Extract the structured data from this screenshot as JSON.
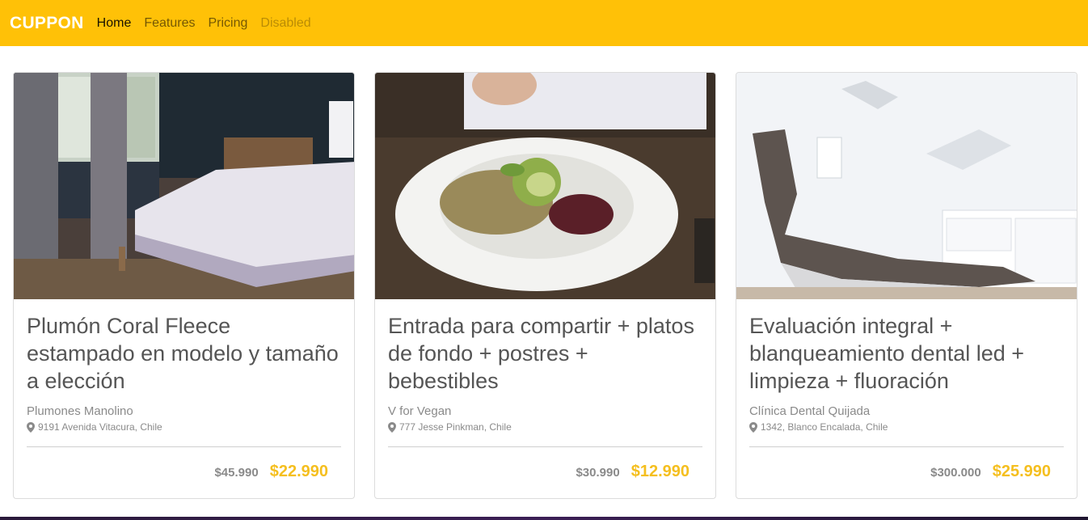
{
  "navbar": {
    "brand": "CUPPON",
    "links": [
      {
        "label": "Home",
        "state": "active"
      },
      {
        "label": "Features",
        "state": "normal"
      },
      {
        "label": "Pricing",
        "state": "normal"
      },
      {
        "label": "Disabled",
        "state": "disabled"
      }
    ],
    "background_color": "#ffc107"
  },
  "cards": [
    {
      "image": "bedroom-photo",
      "title": "Plumón Coral Fleece estampado en modelo y tamaño a elección",
      "merchant": "Plumones Manolino",
      "location": "9191 Avenida Vitacura, Chile",
      "old_price": "$45.990",
      "new_price": "$22.990"
    },
    {
      "image": "vegan-food-photo",
      "title": "Entrada para compartir + platos de fondo + postres + bebestibles",
      "merchant": "V for Vegan",
      "location": "777 Jesse Pinkman, Chile",
      "old_price": "$30.990",
      "new_price": "$12.990"
    },
    {
      "image": "dental-chair-photo",
      "title": "Evaluación integral + blanqueamiento dental led + limpieza + fluoración",
      "merchant": "Clínica Dental Quijada",
      "location": "1342, Blanco Encalada, Chile",
      "old_price": "$300.000",
      "new_price": "$25.990"
    }
  ],
  "colors": {
    "accent": "#ffc107",
    "price_highlight": "#f5bf1f",
    "muted_text": "#8a8a8a"
  }
}
